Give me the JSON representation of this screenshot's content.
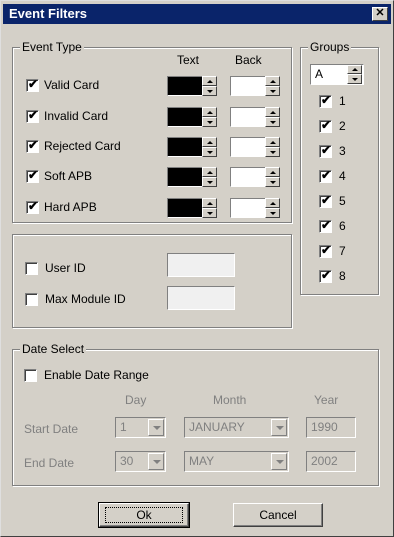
{
  "window": {
    "title": "Event Filters",
    "close_label": "✕"
  },
  "event_type": {
    "legend": "Event Type",
    "text_header": "Text",
    "back_header": "Back",
    "rows": [
      {
        "label": "Valid Card",
        "checked": true
      },
      {
        "label": "Invalid Card",
        "checked": true
      },
      {
        "label": "Rejected Card",
        "checked": true
      },
      {
        "label": "Soft APB",
        "checked": true
      },
      {
        "label": "Hard APB",
        "checked": true
      }
    ],
    "text_color": "#000000",
    "back_color": "#ffffff"
  },
  "groups": {
    "legend": "Groups",
    "spinner_value": "A",
    "items": [
      {
        "label": "1",
        "checked": true
      },
      {
        "label": "2",
        "checked": true
      },
      {
        "label": "3",
        "checked": true
      },
      {
        "label": "4",
        "checked": true
      },
      {
        "label": "5",
        "checked": true
      },
      {
        "label": "6",
        "checked": true
      },
      {
        "label": "7",
        "checked": true
      },
      {
        "label": "8",
        "checked": true
      }
    ]
  },
  "ids": {
    "user_id_label": "User ID",
    "max_module_label": "Max Module ID",
    "user_id_checked": false,
    "max_module_checked": false,
    "user_id_value": "",
    "max_module_value": ""
  },
  "date_select": {
    "legend": "Date Select",
    "enable_label": "Enable Date Range",
    "enable_checked": false,
    "day_header": "Day",
    "month_header": "Month",
    "year_header": "Year",
    "start_label": "Start Date",
    "end_label": "End Date",
    "start_day": "1",
    "start_month": "JANUARY",
    "start_year": "1990",
    "end_day": "30",
    "end_month": "MAY",
    "end_year": "2002"
  },
  "buttons": {
    "ok": "Ok",
    "cancel": "Cancel"
  },
  "check_glyph": "✔"
}
